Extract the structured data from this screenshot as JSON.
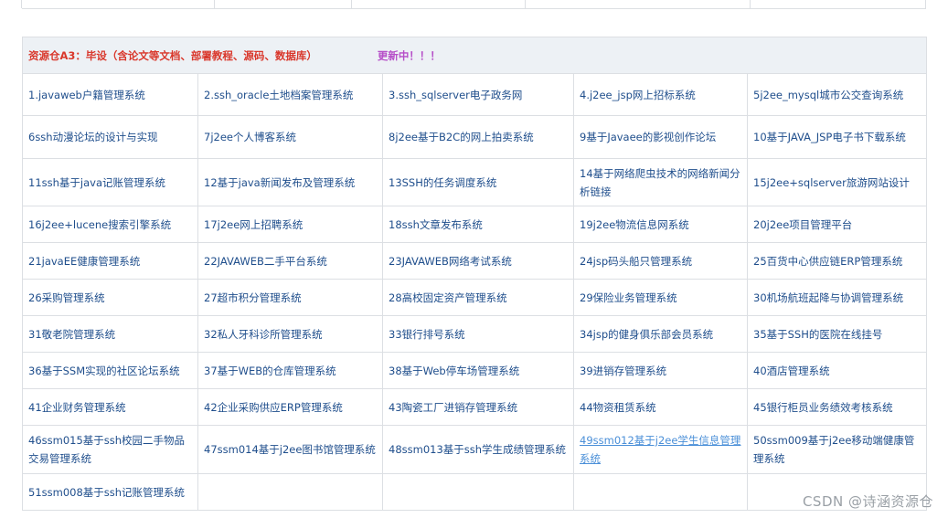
{
  "header": {
    "title": "资源仓A3：毕设（含论文等文档、部署教程、源码、数据库）",
    "status": "更新中！！！"
  },
  "projects": [
    "1.javaweb户籍管理系统",
    "2.ssh_oracle土地档案管理系统",
    "3.ssh_sqlserver电子政务网",
    "4.j2ee_jsp网上招标系统",
    "5j2ee_mysql城市公交查询系统",
    "6ssh动漫论坛的设计与实现",
    "7j2ee个人博客系统",
    "8j2ee基于B2C的网上拍卖系统",
    "9基于Javaee的影视创作论坛",
    "10基于JAVA_JSP电子书下载系统",
    "11ssh基于java记账管理系统",
    "12基于java新闻发布及管理系统",
    "13SSH的任务调度系统",
    "14基于网络爬虫技术的网络新闻分析链接",
    "15j2ee+sqlserver旅游网站设计",
    "16j2ee+lucene搜索引擎系统",
    "17j2ee网上招聘系统",
    "18ssh文章发布系统",
    "19j2ee物流信息网系统",
    "20j2ee项目管理平台",
    "21javaEE健康管理系统",
    "22JAVAWEB二手平台系统",
    "23JAVAWEB网络考试系统",
    "24jsp码头船只管理系统",
    "25百货中心供应链ERP管理系统",
    "26采购管理系统",
    "27超市积分管理系统",
    "28高校固定资产管理系统",
    "29保险业务管理系统",
    "30机场航班起降与协调管理系统",
    "31敬老院管理系统",
    "32私人牙科诊所管理系统",
    "33银行排号系统",
    "34jsp的健身俱乐部会员系统",
    "35基于SSH的医院在线挂号",
    "36基于SSM实现的社区论坛系统",
    "37基于WEB的仓库管理系统",
    "38基于Web停车场管理系统",
    "39进销存管理系统",
    "40酒店管理系统",
    "41企业财务管理系统",
    "42企业采购供应ERP管理系统",
    "43陶瓷工厂进销存管理系统",
    "44物资租赁系统",
    "45银行柜员业务绩效考核系统",
    "46ssm015基于ssh校园二手物品交易管理系统",
    "47ssm014基于j2ee图书馆管理系统",
    "48ssm013基于ssh学生成绩管理系统",
    "49ssm012基于j2ee学生信息管理系统",
    "50ssm009基于j2ee移动端健康管理系统",
    "51ssm008基于ssh记账管理系统"
  ],
  "watermark": "CSDN @诗涵资源仓"
}
